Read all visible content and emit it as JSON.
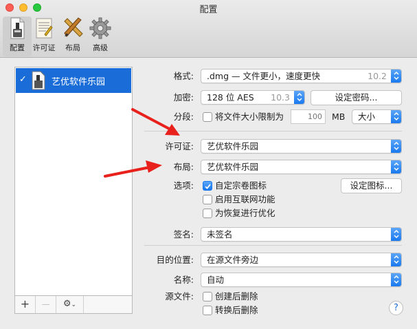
{
  "window": {
    "title": "配置"
  },
  "toolbar": [
    {
      "label": "配置",
      "icon": "disk-image-icon",
      "selected": true
    },
    {
      "label": "许可证",
      "icon": "license-document-icon",
      "selected": false
    },
    {
      "label": "布局",
      "icon": "layout-tools-icon",
      "selected": false
    },
    {
      "label": "高级",
      "icon": "gear-icon",
      "selected": false
    }
  ],
  "sidebar": {
    "items": [
      {
        "label": "艺优软件乐园",
        "checked": true
      }
    ],
    "add_label": "+",
    "remove_label": "—"
  },
  "form": {
    "format": {
      "label": "格式:",
      "value": ".dmg — 文件更小，速度更快",
      "version": "10.2"
    },
    "encryption": {
      "label": "加密:",
      "value": "128 位 AES",
      "version": "10.3",
      "set_password": "设定密码..."
    },
    "segment": {
      "label": "分段:",
      "checkbox_label": "将文件大小限制为",
      "size_placeholder": "100",
      "unit": "MB",
      "size_select": "大小"
    },
    "license": {
      "label": "许可证:",
      "value": "艺优软件乐园"
    },
    "layout": {
      "label": "布局:",
      "value": "艺优软件乐园"
    },
    "options": {
      "label": "选项:",
      "custom_icon": "自定宗卷图标",
      "internet": "启用互联网功能",
      "optimize": "为恢复进行优化",
      "set_icon": "设定图标..."
    },
    "signature": {
      "label": "签名:",
      "value": "未签名"
    },
    "destination": {
      "label": "目的位置:",
      "value": "在源文件旁边"
    },
    "name": {
      "label": "名称:",
      "value": "自动"
    },
    "source": {
      "label": "源文件:",
      "delete_after_create": "创建后删除",
      "delete_after_convert": "转换后删除"
    },
    "help_label": "?"
  },
  "colors": {
    "accent": "#1a6dd8",
    "arrow": "#e8211c"
  }
}
